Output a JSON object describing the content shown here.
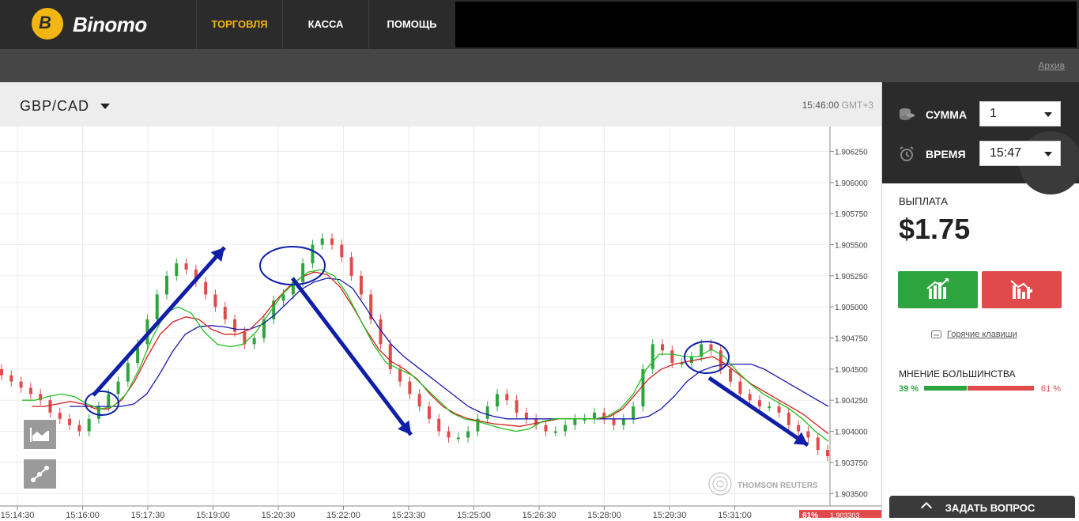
{
  "brand": {
    "name": "Binomo"
  },
  "nav": {
    "tabs": [
      {
        "label": "ТОРГОВЛЯ"
      },
      {
        "label": "КАССА"
      },
      {
        "label": "ПОМОЩЬ"
      }
    ]
  },
  "subbar": {
    "archive_label": "Архив"
  },
  "chart_header": {
    "pair": "GBP/CAD",
    "time": "15:46:00",
    "tz": "GMT+3"
  },
  "panel": {
    "amount_label": "СУММА",
    "amount_value": "1",
    "time_label": "ВРЕМЯ",
    "time_value": "15:47",
    "payout_label": "ВЫПЛАТА",
    "payout_value": "$1.75",
    "hotkeys_label": "Горячие клавиши",
    "opinion_label": "МНЕНИЕ БОЛЬШИНСТВА",
    "opinion_up_pct": "39 %",
    "opinion_down_pct": "61 %",
    "opinion_up_fraction": 0.39
  },
  "ask_button": {
    "label": "ЗАДАТЬ ВОПРОС"
  },
  "watermark": "THOMSON REUTERS",
  "colors": {
    "accent": "#f2b612",
    "up": "#2ea43e",
    "down": "#e04a4a",
    "arrow": "#0f1fa8"
  },
  "price_badge": {
    "pct": "61%",
    "price": "1.903303"
  },
  "chart_data": {
    "type": "line",
    "y_ticks": [
      "1.906250",
      "1.906000",
      "1.905750",
      "1.905500",
      "1.905250",
      "1.905000",
      "1.904750",
      "1.904500",
      "1.904250",
      "1.904000",
      "1.903750",
      "1.903500"
    ],
    "y_tick_values": [
      1.90625,
      1.906,
      1.90575,
      1.9055,
      1.90525,
      1.905,
      1.90475,
      1.9045,
      1.90425,
      1.904,
      1.90375,
      1.9035
    ],
    "x_ticks": [
      "15:14:30",
      "15:16:00",
      "15:17:30",
      "15:19:00",
      "15:20:30",
      "15:22:00",
      "15:23:30",
      "15:25:00",
      "15:26:30",
      "15:28:00",
      "15:29:30",
      "15:31:00"
    ],
    "ylim": [
      1.9034,
      1.90645
    ],
    "close": [
      1.90445,
      1.9044,
      1.90435,
      1.9043,
      1.90425,
      1.90415,
      1.9041,
      1.90405,
      1.904,
      1.9041,
      1.9042,
      1.9043,
      1.9044,
      1.90455,
      1.9047,
      1.9049,
      1.9051,
      1.90525,
      1.90535,
      1.9053,
      1.9052,
      1.9051,
      1.905,
      1.9049,
      1.9048,
      1.9047,
      1.90475,
      1.9049,
      1.90505,
      1.9051,
      1.9052,
      1.90535,
      1.9055,
      1.90555,
      1.9055,
      1.9054,
      1.90525,
      1.9051,
      1.9049,
      1.9047,
      1.9045,
      1.9044,
      1.9043,
      1.9042,
      1.9041,
      1.904,
      1.90395,
      1.90395,
      1.904,
      1.9041,
      1.9042,
      1.9043,
      1.90425,
      1.90415,
      1.9041,
      1.90405,
      1.904,
      1.904,
      1.90405,
      1.9041,
      1.9041,
      1.90415,
      1.9041,
      1.90405,
      1.9041,
      1.9042,
      1.9045,
      1.9047,
      1.90465,
      1.90455,
      1.90455,
      1.9046,
      1.9047,
      1.90465,
      1.9045,
      1.9044,
      1.9043,
      1.90425,
      1.9042,
      1.9042,
      1.90415,
      1.90405,
      1.904,
      1.90395,
      1.90385,
      1.9038
    ],
    "ma_green": [
      1.90425,
      1.90425,
      1.90428,
      1.9043,
      1.90428,
      1.90422,
      1.90418,
      1.9042,
      1.9043,
      1.9045,
      1.90475,
      1.90495,
      1.905,
      1.90495,
      1.9048,
      1.9047,
      1.90468,
      1.9047,
      1.9048,
      1.90495,
      1.9051,
      1.9052,
      1.90528,
      1.9053,
      1.90525,
      1.9051,
      1.9049,
      1.9047,
      1.90455,
      1.9045,
      1.90445,
      1.90435,
      1.90425,
      1.90415,
      1.9041,
      1.90408,
      1.90405,
      1.90402,
      1.904,
      1.90402,
      1.90408,
      1.9041,
      1.9041,
      1.9041,
      1.9041,
      1.90412,
      1.90418,
      1.9043,
      1.9045,
      1.90462,
      1.90462,
      1.9046,
      1.9046,
      1.90466,
      1.9046,
      1.90448,
      1.90438,
      1.9043,
      1.90424,
      1.90418,
      1.9041,
      1.904,
      1.90392
    ],
    "ma_red": [
      1.9042,
      1.9042,
      1.90422,
      1.90424,
      1.90422,
      1.90418,
      1.90418,
      1.90425,
      1.9044,
      1.9046,
      1.90478,
      1.90488,
      1.90492,
      1.9049,
      1.90482,
      1.90478,
      1.90478,
      1.90482,
      1.90492,
      1.90505,
      1.90516,
      1.90524,
      1.90528,
      1.90526,
      1.90516,
      1.905,
      1.90482,
      1.90466,
      1.90456,
      1.9045,
      1.90442,
      1.9043,
      1.9042,
      1.90414,
      1.9041,
      1.90408,
      1.90406,
      1.90405,
      1.90404,
      1.90406,
      1.90408,
      1.9041,
      1.9041,
      1.9041,
      1.9041,
      1.90412,
      1.90418,
      1.9043,
      1.90442,
      1.9045,
      1.90454,
      1.90456,
      1.90458,
      1.9046,
      1.90454,
      1.90446,
      1.90438,
      1.90432,
      1.90426,
      1.9042,
      1.90414,
      1.90406,
      1.90398
    ],
    "ma_blue": [
      1.9042,
      1.9042,
      1.9042,
      1.9042,
      1.9042,
      1.90422,
      1.9043,
      1.90446,
      1.90464,
      1.90478,
      1.90484,
      1.90485,
      1.90484,
      1.90482,
      1.90482,
      1.90486,
      1.90494,
      1.90504,
      1.90514,
      1.9052,
      1.90523,
      1.90522,
      1.90515,
      1.905,
      1.90484,
      1.9047,
      1.9046,
      1.90452,
      1.90444,
      1.90436,
      1.90428,
      1.9042,
      1.90415,
      1.90412,
      1.9041,
      1.9041,
      1.9041,
      1.9041,
      1.9041,
      1.9041,
      1.9041,
      1.9041,
      1.9041,
      1.9041,
      1.9041,
      1.90412,
      1.90418,
      1.90428,
      1.9044,
      1.90448,
      1.90452,
      1.90454,
      1.90454,
      1.90454,
      1.9045,
      1.90444,
      1.90438,
      1.90432,
      1.90426,
      1.9042
    ]
  }
}
